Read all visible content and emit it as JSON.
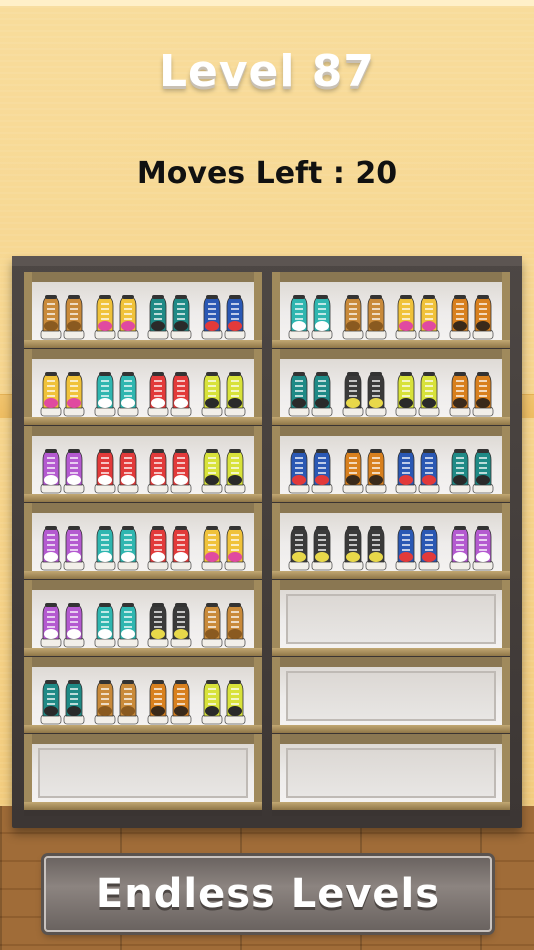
{
  "header": {
    "level_label": "Level 87",
    "moves_label": "Moves Left : 20"
  },
  "banner": {
    "text": "Endless Levels"
  },
  "colors": {
    "tan": "#c98a3a",
    "graffiti": "#f0c23a",
    "teal": "#2fb6b0",
    "darkteal": "#1f8a86",
    "blue": "#2a58b4",
    "red": "#e23a3a",
    "lime": "#d8e23a",
    "orange": "#d8801e",
    "camo": "#3a3a3a",
    "purple": "#b45ad0",
    "white": "#ffffff"
  },
  "shelf": {
    "left": [
      [
        "tan",
        "graffiti",
        "darkteal",
        "blue"
      ],
      [
        "graffiti",
        "teal",
        "red",
        "lime"
      ],
      [
        "purple",
        "red",
        "red",
        "lime"
      ],
      [
        "purple",
        "teal",
        "red",
        "graffiti"
      ],
      [
        "purple",
        "teal",
        "camo",
        "tan"
      ],
      [
        "darkteal",
        "tan",
        "orange",
        "lime"
      ],
      []
    ],
    "right": [
      [
        "teal",
        "tan",
        "graffiti",
        "orange"
      ],
      [
        "darkteal",
        "camo",
        "lime",
        "orange"
      ],
      [
        "blue",
        "orange",
        "blue",
        "darkteal"
      ],
      [
        "camo",
        "camo",
        "blue",
        "purple"
      ],
      [],
      [],
      []
    ]
  }
}
